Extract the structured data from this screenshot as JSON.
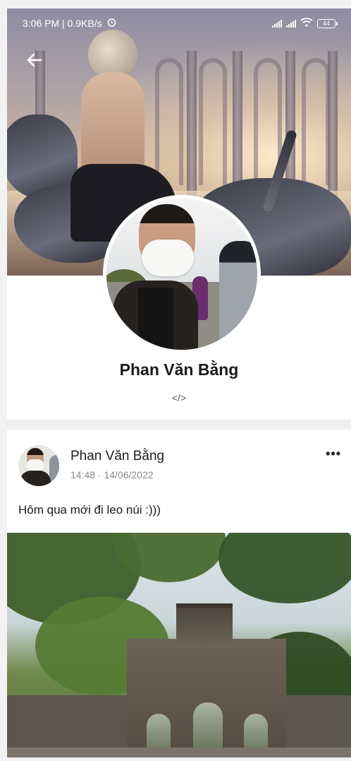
{
  "status_bar": {
    "time_speed": "3:06 PM | 0.9KB/s",
    "battery": "44",
    "alarm_icon": "alarm-icon",
    "wifi_icon": "wifi-icon"
  },
  "header": {
    "back_icon": "back-arrow-icon"
  },
  "profile": {
    "name": "Phan Văn Bằng",
    "bio": "</>"
  },
  "post": {
    "author": "Phan Văn Bằng",
    "timestamp": "14:48 · 14/06/2022",
    "more_label": "•••",
    "text": "Hôm qua mới đi leo núi :)))"
  },
  "colors": {
    "background": "#efefef",
    "card": "#ffffff",
    "text_primary": "#1b1b1b",
    "text_secondary": "#8a8a8a"
  }
}
